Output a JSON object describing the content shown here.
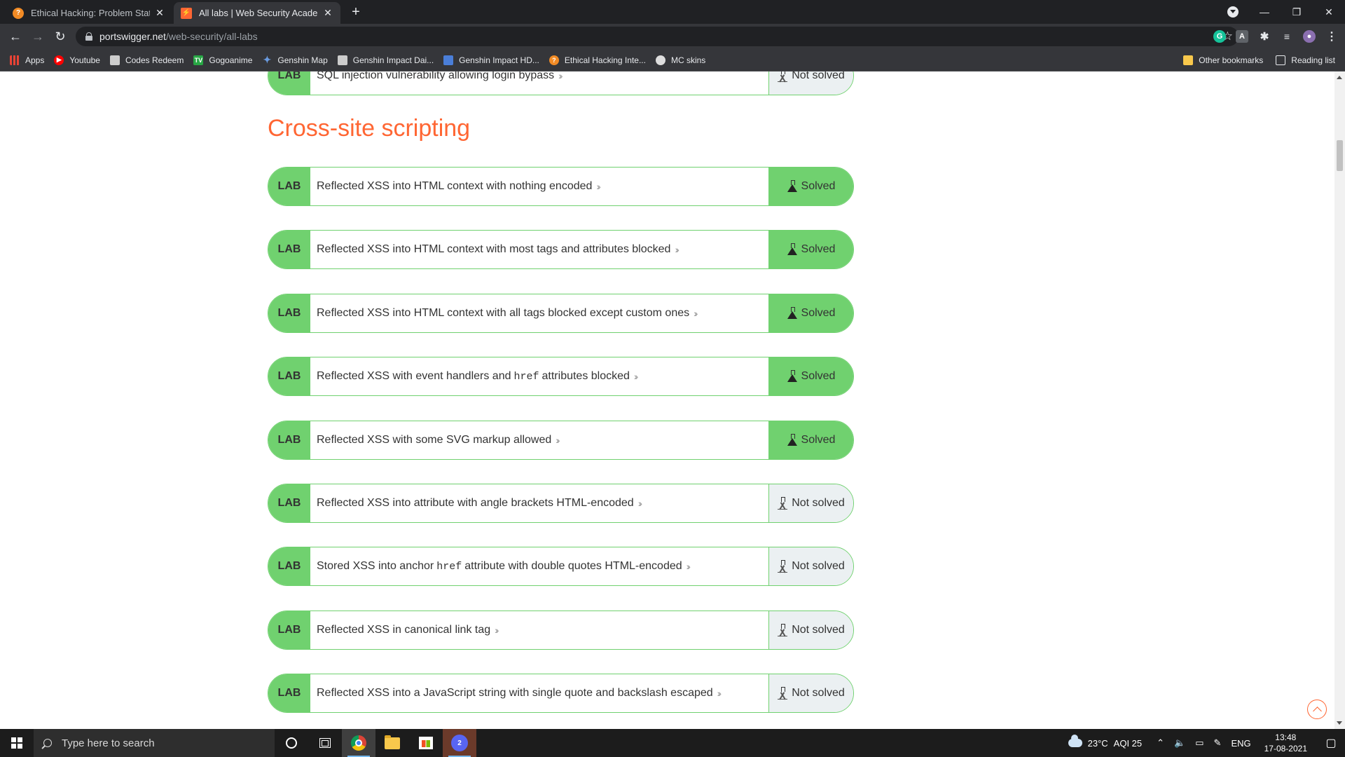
{
  "browser": {
    "tabs": [
      {
        "title": "Ethical Hacking: Problem Statem",
        "active": false,
        "favicon_color": "#f28b25"
      },
      {
        "title": "All labs | Web Security Academy",
        "active": true,
        "favicon_color": "#ff6633"
      }
    ],
    "url_host": "portswigger.net",
    "url_path": "/web-security/all-labs",
    "bookmarks": [
      {
        "label": "Apps",
        "icon": "apps-grid-icon",
        "color": "#ea4335"
      },
      {
        "label": "Youtube",
        "icon": "youtube-icon",
        "color": "#ff0000"
      },
      {
        "label": "Codes Redeem",
        "icon": "codes-redeem-icon",
        "color": "#cccccc"
      },
      {
        "label": "Gogoanime",
        "icon": "gogoanime-icon",
        "color": "#28a745"
      },
      {
        "label": "Genshin Map",
        "icon": "genshin-map-icon",
        "color": "#6a9be0"
      },
      {
        "label": "Genshin Impact Dai...",
        "icon": "genshin-daily-icon",
        "color": "#cccccc"
      },
      {
        "label": "Genshin Impact HD...",
        "icon": "genshin-hd-icon",
        "color": "#4a7ed8"
      },
      {
        "label": "Ethical Hacking Inte...",
        "icon": "ethical-hacking-icon",
        "color": "#f28b25"
      },
      {
        "label": "MC skins",
        "icon": "mc-skins-icon",
        "color": "#dddddd"
      }
    ],
    "other_bookmarks": "Other bookmarks",
    "reading_list": "Reading list"
  },
  "page": {
    "previous_lab": {
      "title": "SQL injection vulnerability allowing login bypass",
      "status": "Not solved"
    },
    "section_title": "Cross-site scripting",
    "lab_badge": "LAB",
    "labs": [
      {
        "pre": "Reflected XSS into HTML context with nothing encoded",
        "code": "",
        "post": "",
        "status": "Solved",
        "solved": true
      },
      {
        "pre": "Reflected XSS into HTML context with most tags and attributes blocked",
        "code": "",
        "post": "",
        "status": "Solved",
        "solved": true
      },
      {
        "pre": "Reflected XSS into HTML context with all tags blocked except custom ones",
        "code": "",
        "post": "",
        "status": "Solved",
        "solved": true
      },
      {
        "pre": "Reflected XSS with event handlers and",
        "code": "href",
        "post": "attributes blocked",
        "status": "Solved",
        "solved": true
      },
      {
        "pre": "Reflected XSS with some SVG markup allowed",
        "code": "",
        "post": "",
        "status": "Solved",
        "solved": true
      },
      {
        "pre": "Reflected XSS into attribute with angle brackets HTML-encoded",
        "code": "",
        "post": "",
        "status": "Not solved",
        "solved": false
      },
      {
        "pre": "Stored XSS into anchor",
        "code": "href",
        "post": "attribute with double quotes HTML-encoded",
        "status": "Not solved",
        "solved": false
      },
      {
        "pre": "Reflected XSS in canonical link tag",
        "code": "",
        "post": "",
        "status": "Not solved",
        "solved": false
      },
      {
        "pre": "Reflected XSS into a JavaScript string with single quote and backslash escaped",
        "code": "",
        "post": "",
        "status": "Not solved",
        "solved": false
      }
    ],
    "colors": {
      "accent": "#ff6633",
      "lab_green": "#70d16f",
      "not_solved_bg": "#ebf0f2"
    }
  },
  "taskbar": {
    "search_placeholder": "Type here to search",
    "weather": "23°C",
    "aqi": "AQI 25",
    "language": "ENG",
    "time": "13:48",
    "date": "17-08-2021",
    "discord_badge": "2"
  }
}
